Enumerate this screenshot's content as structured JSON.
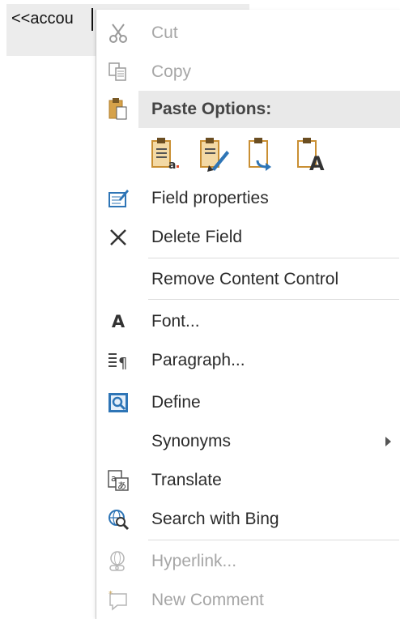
{
  "document": {
    "field_text": "<<accou"
  },
  "menu": {
    "cut": "Cut",
    "copy": "Copy",
    "paste_options_header": "Paste Options:",
    "field_properties": "Field properties",
    "delete_field": "Delete Field",
    "remove_content_control": "Remove Content Control",
    "font": "Font...",
    "paragraph": "Paragraph...",
    "define": "Define",
    "synonyms": "Synonyms",
    "translate": "Translate",
    "search_with_bing": "Search with Bing",
    "hyperlink": "Hyperlink...",
    "new_comment": "New Comment",
    "font_icon_glyph": "A"
  },
  "colors": {
    "accent_blue": "#2e75b6",
    "paste_gold": "#d6a24a",
    "disabled_text": "#a6a6a6",
    "header_bg": "#e9e9e9"
  }
}
